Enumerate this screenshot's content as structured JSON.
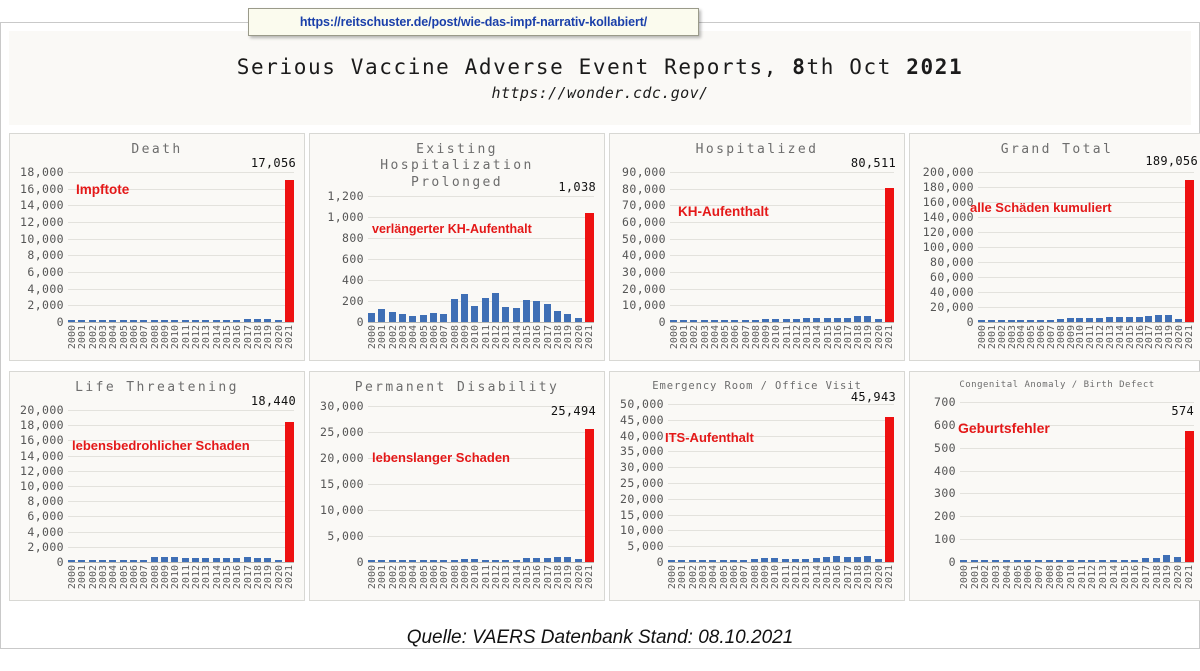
{
  "url_banner": {
    "text": "https://reitschuster.de/post/wie-das-impf-narrativ-kollabiert/"
  },
  "header": {
    "title_part1": "Serious Vaccine Adverse Event Reports, ",
    "title_bold1": "8",
    "title_part2": "th Oct ",
    "title_bold2": "2021",
    "title_full": "Serious Vaccine Adverse Event Reports, 8th Oct 2021",
    "source_url": "https://wonder.cdc.gov/"
  },
  "footer": {
    "caption": "Quelle: VAERS Datenbank Stand: 08.10.2021"
  },
  "colors": {
    "bar_blue": "#3f6fb5",
    "bar_red": "#ee1111",
    "annotation_red": "#e41818",
    "panel_bg": "#faf9f6",
    "url_link": "#1a3faa"
  },
  "chart_data": [
    {
      "type": "bar",
      "title": "Death",
      "annotation": "Impftote",
      "peak_label": "17,056",
      "xlabel": "",
      "ylabel": "",
      "ylim": [
        0,
        18000
      ],
      "ytick_labels": [
        "18,000",
        "16,000",
        "14,000",
        "12,000",
        "10,000",
        "8,000",
        "6,000",
        "4,000",
        "2,000",
        "0"
      ],
      "ytick_values": [
        18000,
        16000,
        14000,
        12000,
        10000,
        8000,
        6000,
        4000,
        2000,
        0
      ],
      "categories": [
        "2000",
        "2001",
        "2002",
        "2003",
        "2004",
        "2005",
        "2006",
        "2007",
        "2008",
        "2009",
        "2010",
        "2011",
        "2012",
        "2013",
        "2014",
        "2015",
        "2016",
        "2017",
        "2018",
        "2019",
        "2020",
        "2021"
      ],
      "values": [
        110,
        120,
        105,
        115,
        130,
        140,
        150,
        160,
        175,
        190,
        200,
        215,
        230,
        245,
        260,
        275,
        290,
        305,
        330,
        360,
        300,
        17056
      ],
      "grid": true
    },
    {
      "type": "bar",
      "title": "Existing Hospitalization Prolonged",
      "annotation": "verlängerter KH-Aufenthalt",
      "peak_label": "1,038",
      "xlabel": "",
      "ylabel": "",
      "ylim": [
        0,
        1200
      ],
      "ytick_labels": [
        "1,200",
        "1,000",
        "800",
        "600",
        "400",
        "200",
        "0"
      ],
      "ytick_values": [
        1200,
        1000,
        800,
        600,
        400,
        200,
        0
      ],
      "categories": [
        "2000",
        "2001",
        "2002",
        "2003",
        "2004",
        "2005",
        "2006",
        "2007",
        "2008",
        "2009",
        "2010",
        "2011",
        "2012",
        "2013",
        "2014",
        "2015",
        "2016",
        "2017",
        "2018",
        "2019",
        "2020",
        "2021"
      ],
      "values": [
        85,
        120,
        100,
        80,
        55,
        70,
        90,
        80,
        215,
        265,
        150,
        225,
        275,
        145,
        135,
        205,
        200,
        170,
        105,
        75,
        35,
        1038
      ],
      "grid": true
    },
    {
      "type": "bar",
      "title": "Hospitalized",
      "annotation": "KH-Aufenthalt",
      "peak_label": "80,511",
      "xlabel": "",
      "ylabel": "",
      "ylim": [
        0,
        90000
      ],
      "ytick_labels": [
        "90,000",
        "80,000",
        "70,000",
        "60,000",
        "50,000",
        "40,000",
        "30,000",
        "20,000",
        "10,000",
        "0"
      ],
      "ytick_values": [
        90000,
        80000,
        70000,
        60000,
        50000,
        40000,
        30000,
        20000,
        10000,
        0
      ],
      "categories": [
        "2000",
        "2001",
        "2002",
        "2003",
        "2004",
        "2005",
        "2006",
        "2007",
        "2008",
        "2009",
        "2010",
        "2011",
        "2012",
        "2013",
        "2014",
        "2015",
        "2016",
        "2017",
        "2018",
        "2019",
        "2020",
        "2021"
      ],
      "values": [
        500,
        550,
        600,
        620,
        680,
        700,
        750,
        800,
        1500,
        1800,
        1900,
        2000,
        2100,
        2200,
        2300,
        2400,
        2500,
        2600,
        3400,
        3700,
        1700,
        80511
      ],
      "grid": true
    },
    {
      "type": "bar",
      "title": "Grand Total",
      "annotation": "alle Schäden kumuliert",
      "peak_label": "189,056",
      "xlabel": "",
      "ylabel": "",
      "ylim": [
        0,
        200000
      ],
      "ytick_labels": [
        "200,000",
        "180,000",
        "160,000",
        "140,000",
        "120,000",
        "100,000",
        "80,000",
        "60,000",
        "40,000",
        "20,000",
        "0"
      ],
      "ytick_values": [
        200000,
        180000,
        160000,
        140000,
        120000,
        100000,
        80000,
        60000,
        40000,
        20000,
        0
      ],
      "categories": [
        "2000",
        "2001",
        "2002",
        "2003",
        "2004",
        "2005",
        "2006",
        "2007",
        "2008",
        "2009",
        "2010",
        "2011",
        "2012",
        "2013",
        "2014",
        "2015",
        "2016",
        "2017",
        "2018",
        "2019",
        "2020",
        "2021"
      ],
      "values": [
        1200,
        1300,
        1400,
        1500,
        1600,
        1700,
        1800,
        1900,
        4500,
        5200,
        5600,
        5800,
        6000,
        6200,
        6400,
        6800,
        7200,
        7600,
        9000,
        9600,
        4000,
        189056
      ],
      "grid": true
    },
    {
      "type": "bar",
      "title": "Life Threatening",
      "annotation": "lebensbedrohlicher Schaden",
      "peak_label": "18,440",
      "xlabel": "",
      "ylabel": "",
      "ylim": [
        0,
        20000
      ],
      "ytick_labels": [
        "20,000",
        "18,000",
        "16,000",
        "14,000",
        "12,000",
        "10,000",
        "8,000",
        "6,000",
        "4,000",
        "2,000",
        "0"
      ],
      "ytick_values": [
        20000,
        18000,
        16000,
        14000,
        12000,
        10000,
        8000,
        6000,
        4000,
        2000,
        0
      ],
      "categories": [
        "2000",
        "2001",
        "2002",
        "2003",
        "2004",
        "2005",
        "2006",
        "2007",
        "2008",
        "2009",
        "2010",
        "2011",
        "2012",
        "2013",
        "2014",
        "2015",
        "2016",
        "2017",
        "2018",
        "2019",
        "2020",
        "2021"
      ],
      "values": [
        180,
        200,
        210,
        220,
        240,
        260,
        280,
        300,
        600,
        680,
        620,
        560,
        540,
        520,
        500,
        480,
        470,
        600,
        520,
        500,
        300,
        18440
      ],
      "grid": true
    },
    {
      "type": "bar",
      "title": "Permanent Disability",
      "annotation": "lebenslanger Schaden",
      "peak_label": "25,494",
      "xlabel": "",
      "ylabel": "",
      "ylim": [
        0,
        30000
      ],
      "ytick_labels": [
        "30,000",
        "25,000",
        "20,000",
        "15,000",
        "10,000",
        "5,000",
        "0"
      ],
      "ytick_values": [
        30000,
        25000,
        20000,
        15000,
        10000,
        5000,
        0
      ],
      "categories": [
        "2000",
        "2001",
        "2002",
        "2003",
        "2004",
        "2005",
        "2006",
        "2007",
        "2008",
        "2009",
        "2010",
        "2011",
        "2012",
        "2013",
        "2014",
        "2015",
        "2016",
        "2017",
        "2018",
        "2019",
        "2020",
        "2021"
      ],
      "values": [
        200,
        220,
        240,
        250,
        260,
        280,
        300,
        320,
        480,
        520,
        500,
        480,
        460,
        440,
        430,
        700,
        760,
        800,
        880,
        900,
        560,
        25494
      ],
      "grid": true
    },
    {
      "type": "bar",
      "title": "Emergency Room / Office Visit",
      "annotation": "ITS-Aufenthalt",
      "peak_label": "45,943",
      "xlabel": "",
      "ylabel": "",
      "ylim": [
        0,
        50000
      ],
      "ytick_labels": [
        "50,000",
        "45,000",
        "40,000",
        "35,000",
        "30,000",
        "25,000",
        "20,000",
        "15,000",
        "10,000",
        "5,000",
        "0"
      ],
      "ytick_values": [
        50000,
        45000,
        40000,
        35000,
        30000,
        25000,
        20000,
        15000,
        10000,
        5000,
        0
      ],
      "categories": [
        "2000",
        "2001",
        "2002",
        "2003",
        "2004",
        "2005",
        "2006",
        "2007",
        "2008",
        "2009",
        "2010",
        "2011",
        "2012",
        "2013",
        "2014",
        "2015",
        "2016",
        "2017",
        "2018",
        "2019",
        "2020",
        "2021"
      ],
      "values": [
        300,
        320,
        340,
        360,
        380,
        400,
        420,
        440,
        1100,
        1200,
        1150,
        1100,
        1050,
        1000,
        1400,
        1500,
        1900,
        1600,
        1700,
        1750,
        900,
        45943
      ],
      "grid": true
    },
    {
      "type": "bar",
      "title": "Congenital Anomaly / Birth Defect",
      "annotation": "Geburtsfehler",
      "peak_label": "574",
      "xlabel": "",
      "ylabel": "",
      "ylim": [
        0,
        700
      ],
      "ytick_labels": [
        "700",
        "600",
        "500",
        "400",
        "300",
        "200",
        "100",
        "0"
      ],
      "ytick_values": [
        700,
        600,
        500,
        400,
        300,
        200,
        100,
        0
      ],
      "categories": [
        "2000",
        "2001",
        "2002",
        "2003",
        "2004",
        "2005",
        "2006",
        "2007",
        "2008",
        "2009",
        "2010",
        "2011",
        "2012",
        "2013",
        "2014",
        "2015",
        "2016",
        "2017",
        "2018",
        "2019",
        "2020",
        "2021"
      ],
      "values": [
        2,
        2,
        2,
        2,
        2,
        2,
        2,
        2,
        2,
        2,
        2,
        2,
        2,
        2,
        2,
        2,
        2,
        18,
        18,
        30,
        20,
        574
      ],
      "grid": true
    }
  ]
}
